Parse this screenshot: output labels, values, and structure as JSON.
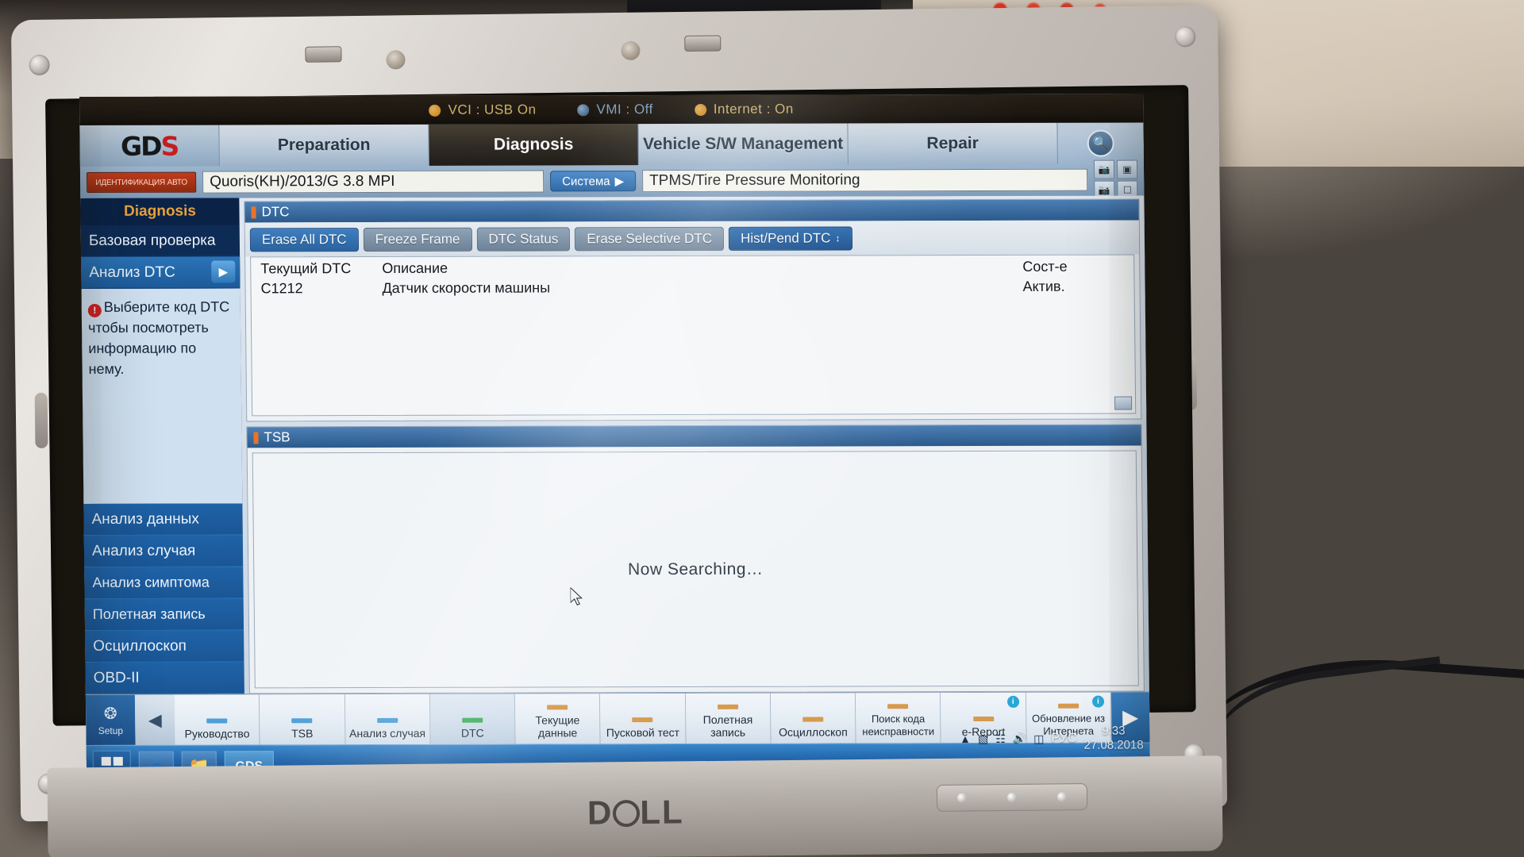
{
  "status_bar": {
    "items": [
      {
        "icon": "orange-dot",
        "label": "VCI : USB On",
        "color": "#e79a22"
      },
      {
        "icon": "blue-dot",
        "label": "VMI : Off",
        "color": "#5b84ad"
      },
      {
        "icon": "orange-dot",
        "label": "Internet : On",
        "color": "#e79a22"
      }
    ],
    "window_buttons": [
      "–",
      "✕"
    ]
  },
  "nav": {
    "logo": {
      "prefix": "GD",
      "suffix": "S"
    },
    "tabs": [
      {
        "label": "Preparation",
        "active": false
      },
      {
        "label": "Diagnosis",
        "active": true
      },
      {
        "label": "Vehicle S/W Management",
        "active": false
      },
      {
        "label": "Repair",
        "active": false
      }
    ],
    "search_icon": "search-icon"
  },
  "vehicle_bar": {
    "id_button_label": "ИДЕНТИФИКАЦИЯ АВТО",
    "vehicle_value": "Quoris(KH)/2013/G 3.8 MPI",
    "system_button_label": "Система",
    "system_value": "TPMS/Tire Pressure Monitoring",
    "right_icons": [
      "camera-icon",
      "screen-icon",
      "camera2-icon",
      "window-icon"
    ]
  },
  "sidebar": {
    "title": "Diagnosis",
    "items": [
      {
        "label": "Базовая проверка",
        "selected": false
      },
      {
        "label": "Анализ DTC",
        "selected": true
      }
    ],
    "hint": "Выберите код DTC чтобы посмотреть информацию по нему.",
    "bottom_items": [
      {
        "label": "Анализ данных"
      },
      {
        "label": "Анализ случая"
      },
      {
        "label": "Анализ симптома"
      },
      {
        "label": "Полетная запись"
      },
      {
        "label": "Осциллоскоп"
      },
      {
        "label": "OBD-II"
      }
    ]
  },
  "dtc_panel": {
    "title": "DTC",
    "buttons": [
      {
        "label": "Erase All DTC",
        "style": "primary"
      },
      {
        "label": "Freeze Frame",
        "style": "normal"
      },
      {
        "label": "DTC Status",
        "style": "normal"
      },
      {
        "label": "Erase Selective DTC",
        "style": "normal"
      },
      {
        "label": "Hist/Pend DTC",
        "style": "accent"
      }
    ],
    "columns": {
      "code": "Текущий DTC",
      "description": "Описание",
      "state": "Сост-е"
    },
    "rows": [
      {
        "code": "C1212",
        "description": "Датчик скорости машины",
        "state": "Актив."
      }
    ]
  },
  "tsb_panel": {
    "title": "TSB",
    "status": "Now Searching…"
  },
  "function_bar": {
    "setup_label": "Setup",
    "nav_prev": "◀",
    "nav_next": "▶",
    "items": [
      {
        "label": "Руководство",
        "bar_color": "#4f9fd8",
        "info": false
      },
      {
        "label": "TSB",
        "bar_color": "#4f9fd8",
        "info": false
      },
      {
        "label": "Анализ случая",
        "bar_color": "#4f9fd8",
        "info": false
      },
      {
        "label": "DTC",
        "bar_color": "#3fae5a",
        "info": false,
        "selected": true
      },
      {
        "label": "Текущие данные",
        "bar_color": "#d79a4e",
        "info": false
      },
      {
        "label": "Пусковой тест",
        "bar_color": "#d79a4e",
        "info": false
      },
      {
        "label": "Полетная запись",
        "bar_color": "#d79a4e",
        "info": false
      },
      {
        "label": "Осциллоскоп",
        "bar_color": "#d79a4e",
        "info": false
      },
      {
        "label": "Поиск кода неисправности",
        "bar_color": "#d79a4e",
        "info": false
      },
      {
        "label": "e-Report",
        "bar_color": "#d79a4e",
        "info": true
      },
      {
        "label": "Обновление из Интернета",
        "bar_color": "#d79a4e",
        "info": true
      }
    ]
  },
  "tray": {
    "language": "РУС",
    "time": "9:33",
    "date": "27.08.2018",
    "icons": [
      "chevron-up-icon",
      "monitor-icon",
      "network-icon",
      "volume-icon",
      "battery-icon"
    ]
  },
  "taskbar": {
    "start_label": "start-button",
    "items": [
      {
        "name": "internet-explorer-icon",
        "glyph": "e"
      },
      {
        "name": "folder-icon",
        "glyph": "▤"
      },
      {
        "name": "gds-app-icon",
        "glyph": "GDS"
      }
    ]
  },
  "laptop": {
    "brand": "D⊙LL",
    "brand_prefix": "D",
    "brand_mid": "○",
    "brand_suffix": "LL"
  },
  "colors": {
    "accent_orange": "#e79a22",
    "accent_blue": "#2a639f",
    "error_red": "#cf2222",
    "sidebar_blue": "#0e2f5c",
    "title_orange": "#e7a33c"
  }
}
